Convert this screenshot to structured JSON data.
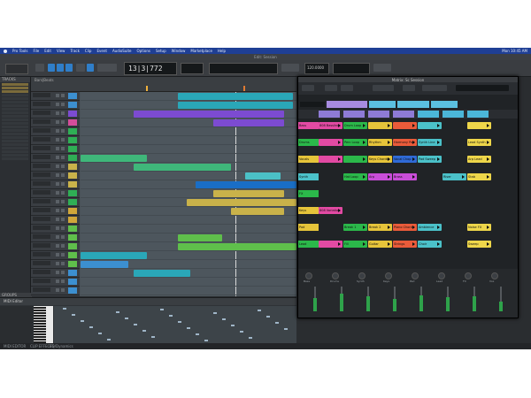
{
  "menu": {
    "app": "Pro Tools",
    "items": [
      "File",
      "Edit",
      "View",
      "Track",
      "Clip",
      "Event",
      "AudioSuite",
      "Options",
      "Setup",
      "Window",
      "Marketplace",
      "Help"
    ],
    "clock": "Mon 10:45 AM"
  },
  "window_title": "Edit: Session",
  "transport": {
    "main_counter": "13|3|772",
    "sub_counter": "",
    "tempo": "120.0000"
  },
  "tracks_panel": {
    "header": "TRACKS",
    "groups": "GROUPS"
  },
  "edit": {
    "ruler_label": "Bars|Beats"
  },
  "midi_editor": {
    "title": "MIDI Editor"
  },
  "status": {
    "left": "MIDI EDITOR",
    "mid": "CLIP EFFECTS",
    "right": "EQ/Dynamics"
  },
  "matrix": {
    "title": "Matrix: Sc Session",
    "rows": [
      "Bass",
      "Drums",
      "Vocals",
      "Synth",
      "FX",
      "Keys",
      "Pad",
      "Lead"
    ],
    "cells": [
      {
        "row": 0,
        "col": 0,
        "text": "808 Bassline",
        "color": "#e24aa3"
      },
      {
        "row": 0,
        "col": 1,
        "text": "Drum Loop",
        "color": "#2bb84a"
      },
      {
        "row": 0,
        "col": 2,
        "text": "",
        "color": "#e6c43a"
      },
      {
        "row": 0,
        "col": 3,
        "text": "",
        "color": "#ea5b3a"
      },
      {
        "row": 0,
        "col": 4,
        "text": "",
        "color": "#4bc1c9"
      },
      {
        "row": 0,
        "col": 6,
        "text": "",
        "color": "#eed64a"
      },
      {
        "row": 1,
        "col": 0,
        "text": "",
        "color": "#e24aa3"
      },
      {
        "row": 1,
        "col": 1,
        "text": "Perc Loop",
        "color": "#2bb84a"
      },
      {
        "row": 1,
        "col": 2,
        "text": "Rhythm",
        "color": "#e6c43a"
      },
      {
        "row": 1,
        "col": 3,
        "text": "Harmony Pad",
        "color": "#ea5b3a"
      },
      {
        "row": 1,
        "col": 4,
        "text": "Synth Line",
        "color": "#4bc1c9"
      },
      {
        "row": 1,
        "col": 6,
        "text": "Lead Synth",
        "color": "#eed64a"
      },
      {
        "row": 2,
        "col": 0,
        "text": "",
        "color": "#e24aa3"
      },
      {
        "row": 2,
        "col": 1,
        "text": "",
        "color": "#2bb84a"
      },
      {
        "row": 2,
        "col": 2,
        "text": "Keys Chords",
        "color": "#e6c43a"
      },
      {
        "row": 2,
        "col": 3,
        "text": "Vocal Chop",
        "color": "#2f6ad7"
      },
      {
        "row": 2,
        "col": 4,
        "text": "Pad Sweep",
        "color": "#4bc1c9"
      },
      {
        "row": 2,
        "col": 6,
        "text": "Arp Lead",
        "color": "#eed64a"
      },
      {
        "row": 3,
        "col": 1,
        "text": "Hat Loop",
        "color": "#2bb84a"
      },
      {
        "row": 3,
        "col": 2,
        "text": "Arp",
        "color": "#c94dd8"
      },
      {
        "row": 3,
        "col": 3,
        "text": "Brass",
        "color": "#c94dd8"
      },
      {
        "row": 3,
        "col": 5,
        "text": "Riser",
        "color": "#4bc1c9"
      },
      {
        "row": 3,
        "col": 6,
        "text": "Stab",
        "color": "#eed64a"
      },
      {
        "row": 5,
        "col": 0,
        "text": "808 Variation",
        "color": "#e24aa3"
      },
      {
        "row": 6,
        "col": 1,
        "text": "Break 1",
        "color": "#2bb84a"
      },
      {
        "row": 6,
        "col": 2,
        "text": "Break 2",
        "color": "#e6c43a"
      },
      {
        "row": 6,
        "col": 3,
        "text": "Piano Chord",
        "color": "#ea5b3a"
      },
      {
        "row": 6,
        "col": 4,
        "text": "Ambience",
        "color": "#4bc1c9"
      },
      {
        "row": 6,
        "col": 6,
        "text": "Noise FX",
        "color": "#eed64a"
      },
      {
        "row": 7,
        "col": 0,
        "text": "",
        "color": "#e24aa3"
      },
      {
        "row": 7,
        "col": 1,
        "text": "Fill",
        "color": "#2bb84a"
      },
      {
        "row": 7,
        "col": 2,
        "text": "Guitar",
        "color": "#e6c43a"
      },
      {
        "row": 7,
        "col": 3,
        "text": "Strings",
        "color": "#ea5b3a"
      },
      {
        "row": 7,
        "col": 4,
        "text": "Choir",
        "color": "#4bc1c9"
      },
      {
        "row": 7,
        "col": 6,
        "text": "Sweep",
        "color": "#eed64a"
      }
    ],
    "scene_labels": [
      "Scene 1",
      "Scene 2",
      "Scene 3",
      "Scene 4",
      "Scene 5",
      "Scene 6",
      "Scene 7",
      "Scene 8"
    ],
    "scene_colors": [
      "#8e7bd6",
      "#8e7bd6",
      "#8e7bd6",
      "#8e7bd6",
      "#4bb6d8",
      "#4bb6d8",
      "#4bb6d8",
      "#2a2d31"
    ],
    "strip_labels": [
      "Bass",
      "Drums",
      "Synth",
      "Keys",
      "Pad",
      "Lead",
      "FX",
      "Vox"
    ],
    "fader_levels": [
      0.55,
      0.7,
      0.6,
      0.5,
      0.65,
      0.58,
      0.62,
      0.4
    ]
  },
  "colors": {
    "menubar": "#1f3f95",
    "accent": "#2f7ec9"
  }
}
